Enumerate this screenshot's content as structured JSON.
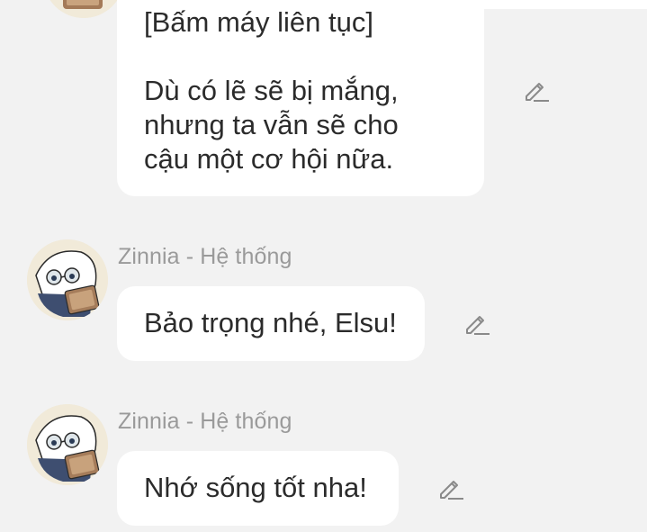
{
  "messages": [
    {
      "sender": "",
      "text": "[Bấm máy liên tục]\n\nDù có lẽ sẽ bị mắng,\nnhưng ta vẫn sẽ cho\ncậu một cơ hội nữa."
    },
    {
      "sender": "Zinnia - Hệ thống",
      "text": "Bảo trọng nhé, Elsu!"
    },
    {
      "sender": "Zinnia - Hệ thống",
      "text": "Nhớ sống tốt nha!"
    }
  ],
  "icons": {
    "edit": "pencil-edit-icon",
    "avatar": "avatar-icon"
  },
  "colors": {
    "background": "#f2f2f2",
    "bubble": "#ffffff",
    "sender_text": "#9a9a9a",
    "message_text": "#2b2b2b",
    "icon": "#8a8a8a"
  }
}
